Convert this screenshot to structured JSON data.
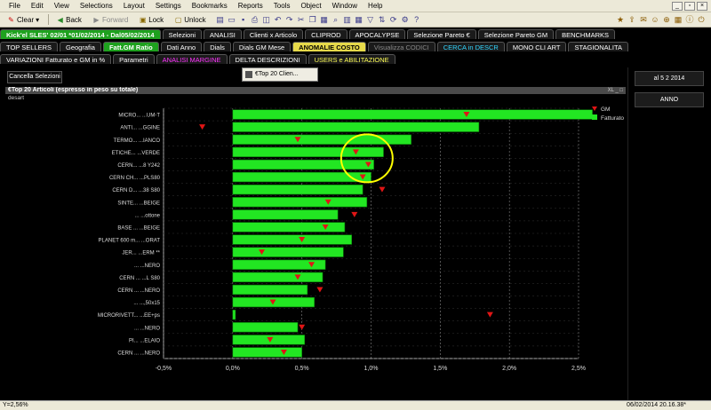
{
  "menu": [
    "File",
    "Edit",
    "View",
    "Selections",
    "Layout",
    "Settings",
    "Bookmarks",
    "Reports",
    "Tools",
    "Object",
    "Window",
    "Help"
  ],
  "toolbar": {
    "clear": "Clear",
    "back": "Back",
    "forward": "Forward",
    "lock": "Lock",
    "unlock": "Unlock"
  },
  "tabs_row1": [
    {
      "label": "Kick'el SLES' 02/01 *01/02/2014 - Dal05/02/2014",
      "style": "green"
    },
    {
      "label": "Selezioni",
      "style": ""
    },
    {
      "label": "ANALISI",
      "style": ""
    },
    {
      "label": "Clienti x Articolo",
      "style": ""
    },
    {
      "label": "CLIPROD",
      "style": ""
    },
    {
      "label": "APOCALYPSE",
      "style": ""
    },
    {
      "label": "Selezione Pareto €",
      "style": ""
    },
    {
      "label": "Selezione Pareto GM",
      "style": ""
    },
    {
      "label": "BENCHMARKS",
      "style": ""
    }
  ],
  "tabs_row2": [
    {
      "label": "TOP SELLERS",
      "style": ""
    },
    {
      "label": "Geografia",
      "style": ""
    },
    {
      "label": "Fatt.GM Ratio",
      "style": "green"
    },
    {
      "label": "Dati Anno",
      "style": ""
    },
    {
      "label": "Dials",
      "style": ""
    },
    {
      "label": "Dials GM Mese",
      "style": ""
    },
    {
      "label": "ANOMALIE COSTO",
      "style": "active"
    },
    {
      "label": "Visualizza CODICI",
      "style": "grey"
    },
    {
      "label": "CERCA in DESCR",
      "style": "cyan"
    },
    {
      "label": "MONO CLI ART",
      "style": ""
    },
    {
      "label": "STAGIONALITA",
      "style": ""
    }
  ],
  "tabs_row3": [
    {
      "label": "VARIAZIONI Fatturato e GM in  %",
      "style": ""
    },
    {
      "label": "Parametri",
      "style": ""
    },
    {
      "label": "ANALISI MARGINE",
      "style": "magenta"
    },
    {
      "label": "DELTA DESCRIZIONI",
      "style": ""
    },
    {
      "label": "USERS e ABILITAZIONE",
      "style": "yellow"
    }
  ],
  "buttons": {
    "cancel": "Cancella Selezioni",
    "top20": "€Top 20 Clien..."
  },
  "right_panel": {
    "date": "al 5 2 2014",
    "year": "ANNO"
  },
  "chart_window": {
    "title": "€Top 20 Articoli (espresso in peso su totale)",
    "subtitle": "desart",
    "controls": "XL _ □"
  },
  "status": {
    "left": "Y=2,56%",
    "right": "06/02/2014 20.16.38*"
  },
  "colors": {
    "bar": "#22e622",
    "marker": "#e01515",
    "highlight_circle": "#ffff00",
    "active_tab": "#e6d94a",
    "green_tab": "#1ea11e"
  },
  "chart_data": {
    "type": "bar",
    "orientation": "horizontal",
    "title": "€Top 20 Articoli (espresso in peso su totale)",
    "xlabel": "",
    "ylabel": "desart",
    "xlim": [
      -0.5,
      2.5
    ],
    "xticks": [
      "-0,5%",
      "0,0%",
      "0,5%",
      "1,0%",
      "1,5%",
      "2,0%",
      "2,5%"
    ],
    "xtick_values": [
      -0.5,
      0,
      0.5,
      1.0,
      1.5,
      2.0,
      2.5
    ],
    "grid": true,
    "legend": "top-right",
    "categories": [
      "MICRO... ...UM-T",
      "ANTI... ...GGINE",
      "TERMO... ...IANCO",
      "ETICHE... ...VERDE",
      "CERN... ...8 Y242",
      "CERN CH... ...PLS80",
      "CERN D... ...38 S80",
      "SINTE... ...BEIGE",
      "... ...ottone",
      "BASE ... ...BEIGE",
      "PLANET 600 m... ...ORAT",
      "JER... ...ERM **",
      "... ...NERO",
      "CERN ... ...L S80",
      "CERN ... ...NERO",
      "... ...,50x15",
      "MICRORIVETT... ...EE+ps",
      "... ...NERO",
      "PI... ...ELAIO",
      "CERN ... ...NERO"
    ],
    "series": [
      {
        "name": "Fatturato",
        "values": [
          2.6,
          1.78,
          1.29,
          1.09,
          1.02,
          1.0,
          0.94,
          0.97,
          0.76,
          0.81,
          0.86,
          0.8,
          0.67,
          0.65,
          0.54,
          0.59,
          0.02,
          0.47,
          0.52,
          0.5
        ]
      },
      {
        "name": "GM",
        "values": [
          1.69,
          -0.22,
          0.47,
          0.89,
          0.98,
          0.94,
          1.08,
          0.69,
          0.88,
          0.67,
          0.5,
          0.21,
          0.57,
          0.47,
          0.63,
          0.29,
          1.86,
          0.5,
          0.27,
          0.37
        ]
      }
    ],
    "annotations": [
      {
        "type": "circle",
        "at_category": "ETICHE... ...VERDE",
        "near_x": 0.97
      }
    ]
  }
}
